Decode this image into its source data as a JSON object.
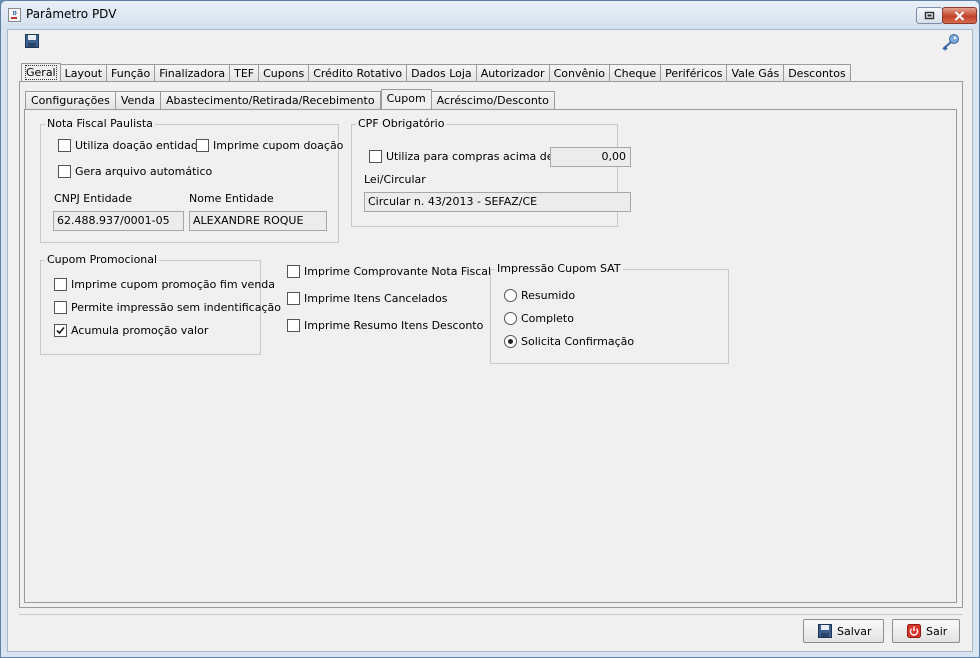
{
  "window": {
    "title": "Parâmetro PDV"
  },
  "main_tabs": [
    {
      "label": "Geral",
      "active": true
    },
    {
      "label": "Layout"
    },
    {
      "label": "Função"
    },
    {
      "label": "Finalizadora"
    },
    {
      "label": "TEF"
    },
    {
      "label": "Cupons"
    },
    {
      "label": "Crédito Rotativo"
    },
    {
      "label": "Dados Loja"
    },
    {
      "label": "Autorizador"
    },
    {
      "label": "Convênio"
    },
    {
      "label": "Cheque"
    },
    {
      "label": "Periféricos"
    },
    {
      "label": "Vale Gás"
    },
    {
      "label": "Descontos"
    }
  ],
  "sub_tabs": [
    {
      "label": "Configurações"
    },
    {
      "label": "Venda"
    },
    {
      "label": "Abastecimento/Retirada/Recebimento"
    },
    {
      "label": "Cupom",
      "active": true
    },
    {
      "label": "Acréscimo/Desconto"
    }
  ],
  "nota_fiscal_paulista": {
    "title": "Nota Fiscal Paulista",
    "utiliza_doacao": {
      "label": "Utiliza doação entidade",
      "checked": false
    },
    "imprime_cupom_doacao": {
      "label": "Imprime cupom doação",
      "checked": false
    },
    "gera_arquivo": {
      "label": "Gera arquivo automático",
      "checked": false
    },
    "cnpj_label": "CNPJ Entidade",
    "cnpj_value": "62.488.937/0001-05",
    "nome_label": "Nome Entidade",
    "nome_value": "ALEXANDRE ROQUE"
  },
  "cpf_obrigatorio": {
    "title": "CPF Obrigatório",
    "utiliza_compras": {
      "label": "Utiliza para compras acima de R$",
      "checked": false
    },
    "valor": "0,00",
    "lei_label": "Lei/Circular",
    "lei_value": "Circular n. 43/2013 - SEFAZ/CE"
  },
  "cupom_promocional": {
    "title": "Cupom Promocional",
    "imprime_fim_venda": {
      "label": "Imprime cupom promoção fim venda",
      "checked": false
    },
    "permite_sem_ident": {
      "label": "Permite impressão sem indentificação",
      "checked": false
    },
    "acumula_valor": {
      "label": "Acumula promoção valor",
      "checked": true
    }
  },
  "opcoes": {
    "comprovante_nf": {
      "label": "Imprime Comprovante Nota Fiscal",
      "checked": false
    },
    "itens_cancelados": {
      "label": "Imprime Itens Cancelados",
      "checked": false
    },
    "resumo_desconto": {
      "label": "Imprime Resumo Itens Desconto",
      "checked": false
    }
  },
  "impressao_sat": {
    "title": "Impressão Cupom SAT",
    "options": [
      {
        "label": "Resumido",
        "selected": false
      },
      {
        "label": "Completo",
        "selected": false
      },
      {
        "label": "Solicita Confirmação",
        "selected": true
      }
    ]
  },
  "buttons": {
    "salvar": "Salvar",
    "sair": "Sair"
  },
  "colors": {
    "title_bg": "#d4e0ee",
    "close_red": "#c2422a",
    "panel_bg": "#f0f0f0"
  }
}
